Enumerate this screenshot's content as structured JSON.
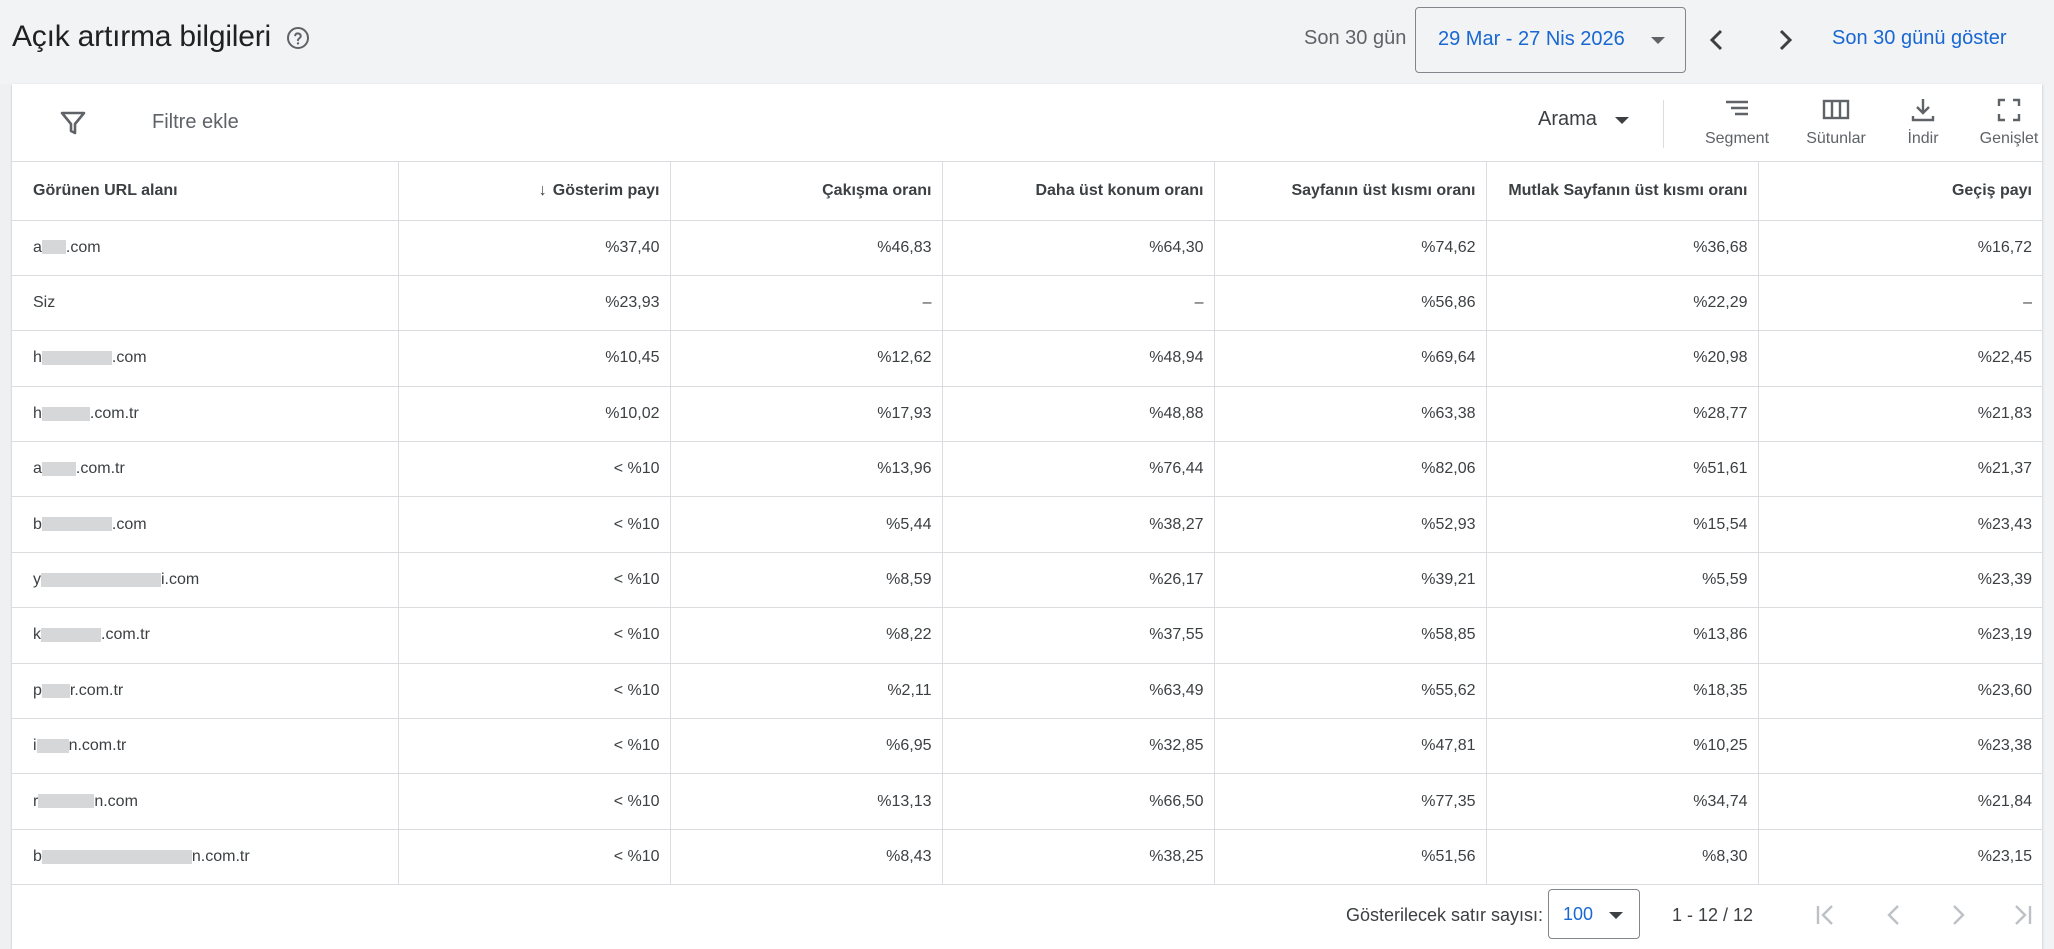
{
  "header": {
    "title": "Açık artırma bilgileri",
    "period_label": "Son 30 gün",
    "date_range": "29 Mar - 27 Nis 2026",
    "show_link": "Son 30 günü göster"
  },
  "toolbar": {
    "filter_label": "Filtre ekle",
    "network_select": "Arama",
    "tools": [
      {
        "label": "Segment",
        "icon": "segment-icon"
      },
      {
        "label": "Sütunlar",
        "icon": "columns-icon"
      },
      {
        "label": "İndir",
        "icon": "download-icon"
      },
      {
        "label": "Genişlet",
        "icon": "expand-icon"
      }
    ]
  },
  "table": {
    "columns": [
      "Görünen URL alanı",
      "Gösterim payı",
      "Çakışma oranı",
      "Daha üst konum oranı",
      "Sayfanın üst kısmı oranı",
      "Mutlak Sayfanın üst kısmı oranı",
      "Geçiş payı"
    ],
    "sorted_column": "Gösterim payı",
    "sort_direction": "descending",
    "rows": [
      {
        "domain_prefix": "a",
        "domain_suffix": ".com",
        "cells": [
          "%37,40",
          "%46,83",
          "%64,30",
          "%74,62",
          "%36,68",
          "%16,72"
        ]
      },
      {
        "domain_prefix": "Siz",
        "domain_suffix": "",
        "cells": [
          "%23,93",
          "–",
          "–",
          "%56,86",
          "%22,29",
          "–"
        ]
      },
      {
        "domain_prefix": "h",
        "domain_suffix": ".com",
        "cells": [
          "%10,45",
          "%12,62",
          "%48,94",
          "%69,64",
          "%20,98",
          "%22,45"
        ]
      },
      {
        "domain_prefix": "h",
        "domain_suffix": ".com.tr",
        "cells": [
          "%10,02",
          "%17,93",
          "%48,88",
          "%63,38",
          "%28,77",
          "%21,83"
        ]
      },
      {
        "domain_prefix": "a",
        "domain_suffix": ".com.tr",
        "cells": [
          "< %10",
          "%13,96",
          "%76,44",
          "%82,06",
          "%51,61",
          "%21,37"
        ]
      },
      {
        "domain_prefix": "b",
        "domain_suffix": ".com",
        "cells": [
          "< %10",
          "%5,44",
          "%38,27",
          "%52,93",
          "%15,54",
          "%23,43"
        ]
      },
      {
        "domain_prefix": "y",
        "domain_suffix": "i.com",
        "cells": [
          "< %10",
          "%8,59",
          "%26,17",
          "%39,21",
          "%5,59",
          "%23,39"
        ]
      },
      {
        "domain_prefix": "k",
        "domain_suffix": ".com.tr",
        "cells": [
          "< %10",
          "%8,22",
          "%37,55",
          "%58,85",
          "%13,86",
          "%23,19"
        ]
      },
      {
        "domain_prefix": "p",
        "domain_suffix": "r.com.tr",
        "cells": [
          "< %10",
          "%2,11",
          "%63,49",
          "%55,62",
          "%18,35",
          "%23,60"
        ]
      },
      {
        "domain_prefix": "i",
        "domain_suffix": "n.com.tr",
        "cells": [
          "< %10",
          "%6,95",
          "%32,85",
          "%47,81",
          "%10,25",
          "%23,38"
        ]
      },
      {
        "domain_prefix": "r",
        "domain_suffix": "n.com",
        "cells": [
          "< %10",
          "%13,13",
          "%66,50",
          "%77,35",
          "%34,74",
          "%21,84"
        ]
      },
      {
        "domain_prefix": "b",
        "domain_suffix": "n.com.tr",
        "cells": [
          "< %10",
          "%8,43",
          "%38,25",
          "%51,56",
          "%8,30",
          "%23,15"
        ]
      }
    ]
  },
  "footer": {
    "rows_label": "Gösterilecek satır sayısı:",
    "rows_value": "100",
    "range_text": "1 - 12 / 12"
  },
  "colors": {
    "accent": "#1967d2",
    "header_bg": "#f1f3f4",
    "border": "#dadce0"
  }
}
